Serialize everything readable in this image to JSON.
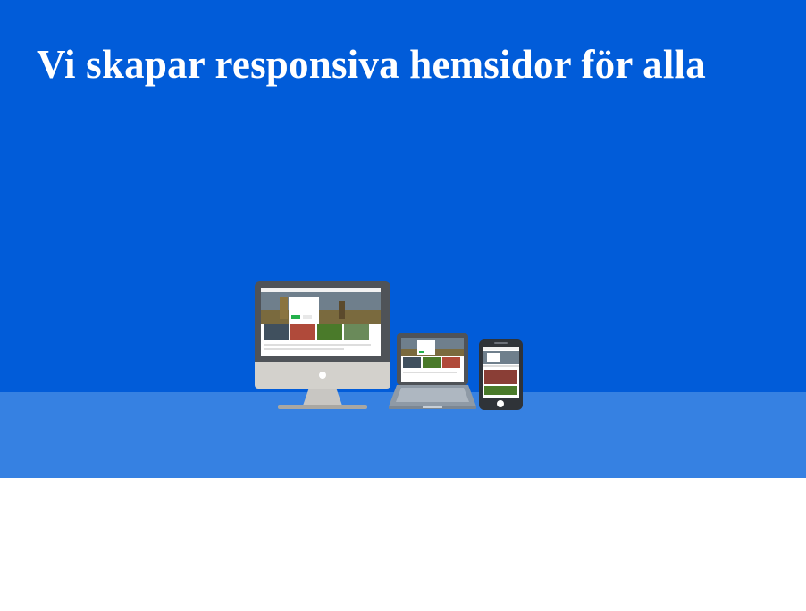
{
  "hero": {
    "title": "Vi skapar responsiva hemsidor för alla",
    "background_color": "#015cd9",
    "floor_color": "#3681e2",
    "illustration": {
      "icon": "responsive-devices-illustration",
      "devices": [
        "desktop-monitor",
        "laptop",
        "smartphone"
      ]
    }
  }
}
